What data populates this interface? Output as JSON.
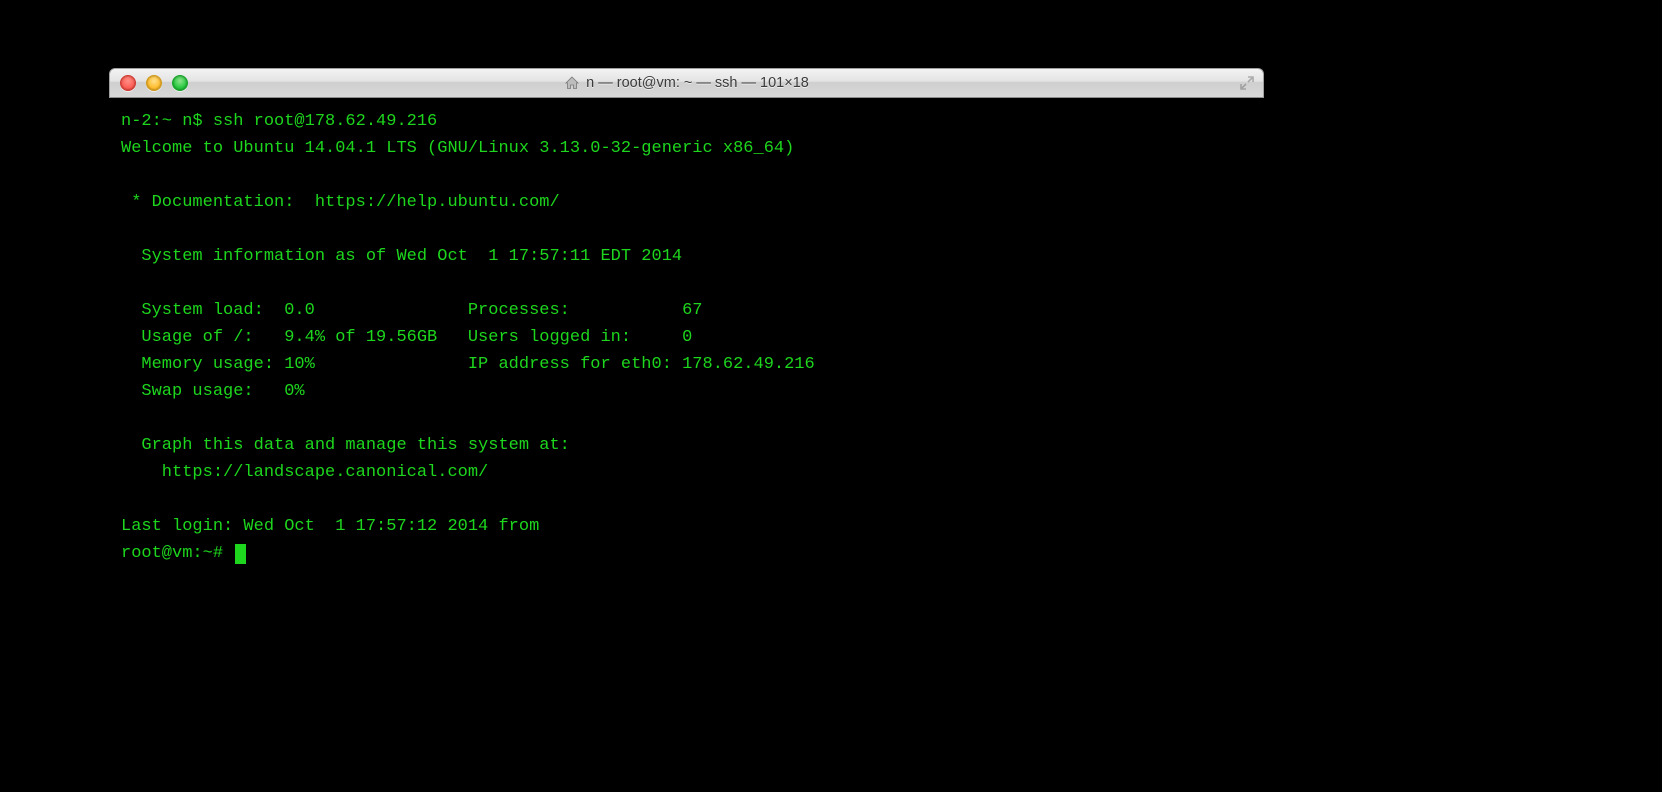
{
  "window": {
    "title": "n — root@vm: ~ — ssh — 101×18"
  },
  "terminal": {
    "line_local_prompt": "n-2:~ n$ ssh root@178.62.49.216",
    "line_welcome": "Welcome to Ubuntu 14.04.1 LTS (GNU/Linux 3.13.0-32-generic x86_64)",
    "line_docs": " * Documentation:  https://help.ubuntu.com/",
    "line_sysinfo": "  System information as of Wed Oct  1 17:57:11 EDT 2014",
    "line_stat1": "  System load:  0.0               Processes:           67",
    "line_stat2": "  Usage of /:   9.4% of 19.56GB   Users logged in:     0",
    "line_stat3": "  Memory usage: 10%               IP address for eth0: 178.62.49.216",
    "line_stat4": "  Swap usage:   0%",
    "line_graph1": "  Graph this data and manage this system at:",
    "line_graph2": "    https://landscape.canonical.com/",
    "line_last_login": "Last login: Wed Oct  1 17:57:12 2014 from",
    "line_remote_prompt": "root@vm:~# "
  }
}
